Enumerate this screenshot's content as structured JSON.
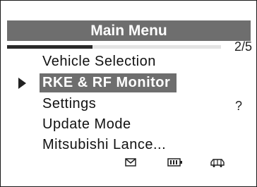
{
  "screen": {
    "title": "Main Menu",
    "page_indicator": "2/5",
    "progress_fraction": 0.4,
    "help_label": "?"
  },
  "menu": {
    "items": [
      {
        "label": "Vehicle Selection",
        "selected": false
      },
      {
        "label": "RKE  &  RF Monitor",
        "selected": true
      },
      {
        "label": "Settings",
        "selected": false
      },
      {
        "label": "Update Mode",
        "selected": false
      },
      {
        "label": "Mitsubishi Lance...",
        "selected": false
      }
    ]
  },
  "status_icons": [
    "mail-icon",
    "battery-icon",
    "vehicle-link-icon"
  ],
  "colors": {
    "highlight_background": "#6e6e6e",
    "highlight_text": "#ffffff",
    "text": "#111111"
  }
}
